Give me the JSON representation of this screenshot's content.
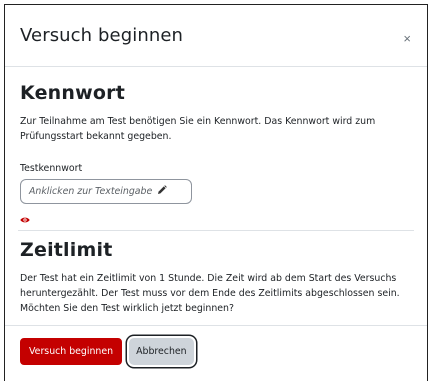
{
  "dialog": {
    "title": "Versuch beginnen",
    "close_label": "×"
  },
  "password_section": {
    "heading": "Kennwort",
    "description": "Zur Teilnahme am Test benötigen Sie ein Kennwort. Das Kennwort wird zum Prüfungsstart bekannt gegeben.",
    "field_label": "Testkennwort",
    "field_placeholder": "Anklicken zur Texteingabe",
    "edit_icon": "pencil-icon",
    "reveal_icon": "eye-icon"
  },
  "time_section": {
    "heading": "Zeitlimit",
    "description": "Der Test hat ein Zeitlimit von 1 Stunde. Die Zeit wird ab dem Start des Versuchs heruntergezählt. Der Test muss vor dem Ende des Zeitlimits abgeschlossen sein. Möchten Sie den Test wirklich jetzt beginnen?"
  },
  "footer": {
    "start_label": "Versuch beginnen",
    "cancel_label": "Abbrechen"
  },
  "colors": {
    "primary": "#c40000",
    "secondary": "#ced4da",
    "text": "#1d2125"
  }
}
